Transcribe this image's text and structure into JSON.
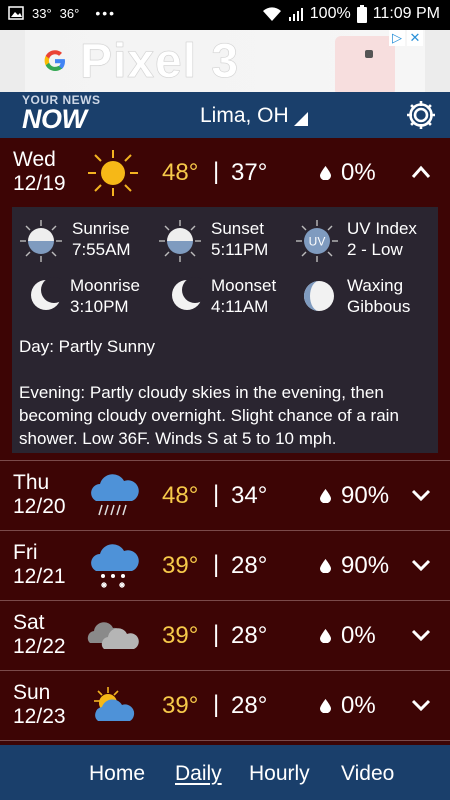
{
  "status_bar": {
    "temp_left": "33°",
    "temp_right": "36°",
    "dots": "•••",
    "battery": "100%",
    "time": "11:09 PM"
  },
  "ad": {
    "title": "Pixel 3",
    "brand_letter": "G"
  },
  "header": {
    "logo_top": "YOUR NEWS",
    "logo_bottom": "NOW",
    "location": "Lima, OH"
  },
  "days": [
    {
      "day": "Wed",
      "date": "12/19",
      "hi": "48°",
      "lo": "37°",
      "precip": "0%",
      "icon": "sunny-icon",
      "expanded": true
    },
    {
      "day": "Thu",
      "date": "12/20",
      "hi": "48°",
      "lo": "34°",
      "precip": "90%",
      "icon": "rain-icon",
      "expanded": false
    },
    {
      "day": "Fri",
      "date": "12/21",
      "hi": "39°",
      "lo": "28°",
      "precip": "90%",
      "icon": "snow-icon",
      "expanded": false
    },
    {
      "day": "Sat",
      "date": "12/22",
      "hi": "39°",
      "lo": "28°",
      "precip": "0%",
      "icon": "cloudy-icon",
      "expanded": false
    },
    {
      "day": "Sun",
      "date": "12/23",
      "hi": "39°",
      "lo": "28°",
      "precip": "0%",
      "icon": "partly-sunny-icon",
      "expanded": false
    }
  ],
  "separator": "|",
  "details": {
    "sunrise_label": "Sunrise",
    "sunrise_time": "7:55AM",
    "sunset_label": "Sunset",
    "sunset_time": "5:11PM",
    "uv_label": "UV Index",
    "uv_value": "2 - Low",
    "uv_icon_text": "UV",
    "moonrise_label": "Moonrise",
    "moonrise_time": "3:10PM",
    "moonset_label": "Moonset",
    "moonset_time": "4:11AM",
    "phase_line1": "Waxing",
    "phase_line2": "Gibbous",
    "day_text": "Day: Partly Sunny",
    "evening_text": "Evening: Partly cloudy skies in the evening, then becoming cloudy overnight. Slight chance of a rain shower. Low 36F. Winds S at 5 to 10 mph."
  },
  "nav": {
    "home": "Home",
    "daily": "Daily",
    "hourly": "Hourly",
    "video": "Video",
    "active": "Daily"
  },
  "colors": {
    "background": "#3d0505",
    "header": "#1a3f6b",
    "high_temp": "#f6c94a",
    "details_panel": "#2a2530"
  }
}
